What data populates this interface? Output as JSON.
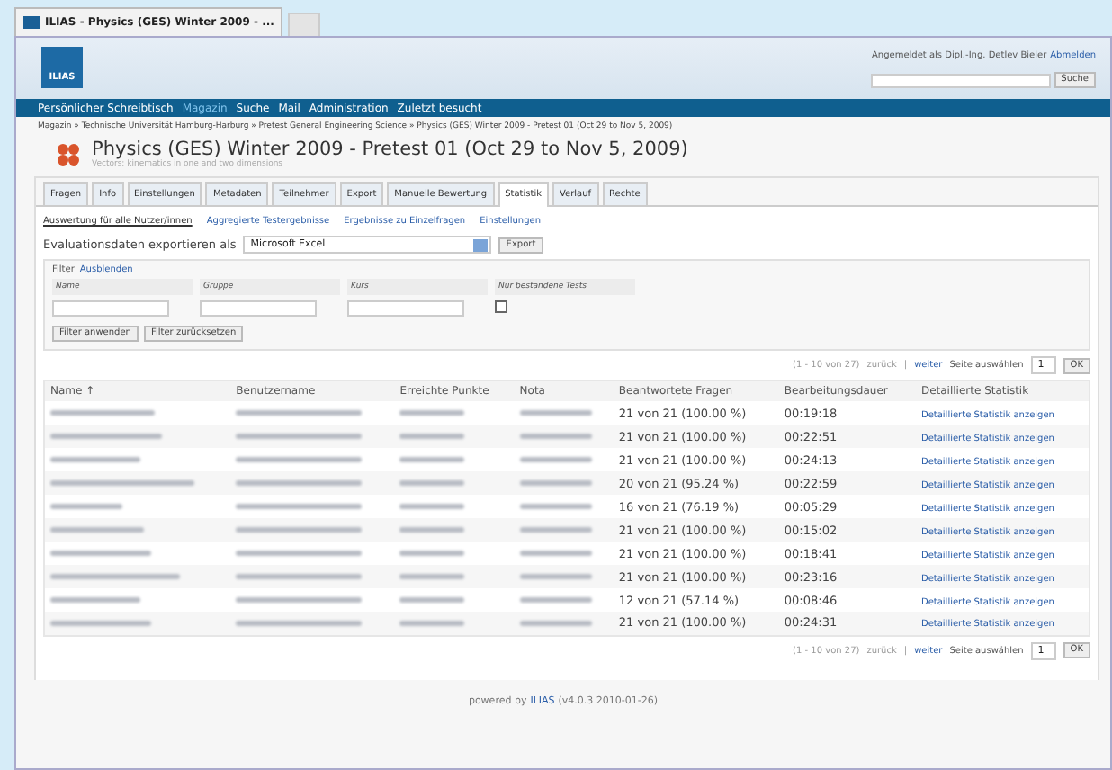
{
  "browser_tab": {
    "title": "ILIAS - Physics (GES) Winter 2009 - ..."
  },
  "header": {
    "logo": "ILIAS",
    "login_text": "Angemeldet als Dipl.-Ing. Detlev Bieler",
    "logout": "Abmelden",
    "search_button": "Suche"
  },
  "main_menu": [
    {
      "label": "Persönlicher Schreibtisch",
      "selected": false
    },
    {
      "label": "Magazin",
      "selected": true
    },
    {
      "label": "Suche",
      "selected": false
    },
    {
      "label": "Mail",
      "selected": false
    },
    {
      "label": "Administration",
      "selected": false
    },
    {
      "label": "Zuletzt besucht",
      "selected": false
    }
  ],
  "breadcrumb": "Magazin » Technische Universität Hamburg-Harburg » Pretest General Engineering Science » Physics (GES) Winter 2009 - Pretest 01 (Oct 29 to Nov 5, 2009)",
  "title": "Physics (GES) Winter 2009 - Pretest 01 (Oct 29 to Nov 5, 2009)",
  "subtitle": "Vectors; kinematics in one and two dimensions",
  "tabs": [
    {
      "label": "Fragen",
      "selected": false
    },
    {
      "label": "Info",
      "selected": false
    },
    {
      "label": "Einstellungen",
      "selected": false
    },
    {
      "label": "Metadaten",
      "selected": false
    },
    {
      "label": "Teilnehmer",
      "selected": false
    },
    {
      "label": "Export",
      "selected": false
    },
    {
      "label": "Manuelle Bewertung",
      "selected": false
    },
    {
      "label": "Statistik",
      "selected": true
    },
    {
      "label": "Verlauf",
      "selected": false
    },
    {
      "label": "Rechte",
      "selected": false
    }
  ],
  "subtabs": [
    {
      "label": "Auswertung für alle Nutzer/innen",
      "selected": true
    },
    {
      "label": "Aggregierte Testergebnisse",
      "selected": false
    },
    {
      "label": "Ergebnisse zu Einzelfragen",
      "selected": false
    },
    {
      "label": "Einstellungen",
      "selected": false
    }
  ],
  "export": {
    "label": "Evaluationsdaten exportieren als",
    "format": "Microsoft Excel",
    "button": "Export"
  },
  "filter": {
    "title": "Filter",
    "toggle": "Ausblenden",
    "fields": [
      {
        "label": "Name",
        "kind": "text"
      },
      {
        "label": "Gruppe",
        "kind": "text"
      },
      {
        "label": "Kurs",
        "kind": "text"
      },
      {
        "label": "Nur bestandene Tests",
        "kind": "checkbox",
        "checked": false
      }
    ],
    "buttons": [
      "Filter anwenden",
      "Filter zurücksetzen"
    ]
  },
  "pagination": [
    {
      "range": "(1 - 10 von 27)",
      "prev": "zurück",
      "separator": "|",
      "next": "weiter",
      "page_label": "Seite auswählen",
      "page": "1",
      "ok": "OK"
    },
    {
      "range": "(1 - 10 von 27)",
      "prev": "zurück",
      "separator": "|",
      "next": "weiter",
      "page_label": "Seite auswählen",
      "page": "1",
      "ok": "OK"
    }
  ],
  "table": {
    "columns": [
      "Name ↑",
      "Benutzername",
      "Erreichte Punkte",
      "Nota",
      "Beantwortete Fragen",
      "Bearbeitungsdauer",
      "Detaillierte Statistik"
    ],
    "rows": [
      {
        "answered": "21 von 21 (100.00 %)",
        "duration": "00:19:18",
        "link": "Detaillierte Statistik anzeigen"
      },
      {
        "answered": "21 von 21 (100.00 %)",
        "duration": "00:22:51",
        "link": "Detaillierte Statistik anzeigen"
      },
      {
        "answered": "21 von 21 (100.00 %)",
        "duration": "00:24:13",
        "link": "Detaillierte Statistik anzeigen"
      },
      {
        "answered": "20 von 21 (95.24 %)",
        "duration": "00:22:59",
        "link": "Detaillierte Statistik anzeigen"
      },
      {
        "answered": "16 von 21 (76.19 %)",
        "duration": "00:05:29",
        "link": "Detaillierte Statistik anzeigen"
      },
      {
        "answered": "21 von 21 (100.00 %)",
        "duration": "00:15:02",
        "link": "Detaillierte Statistik anzeigen"
      },
      {
        "answered": "21 von 21 (100.00 %)",
        "duration": "00:18:41",
        "link": "Detaillierte Statistik anzeigen"
      },
      {
        "answered": "21 von 21 (100.00 %)",
        "duration": "00:23:16",
        "link": "Detaillierte Statistik anzeigen"
      },
      {
        "answered": "12 von 21 (57.14 %)",
        "duration": "00:08:46",
        "link": "Detaillierte Statistik anzeigen"
      },
      {
        "answered": "21 von 21 (100.00 %)",
        "duration": "00:24:31",
        "link": "Detaillierte Statistik anzeigen"
      }
    ]
  },
  "footer": {
    "prefix": "powered by",
    "link": "ILIAS",
    "version": "(v4.0.3 2010-01-26)"
  }
}
